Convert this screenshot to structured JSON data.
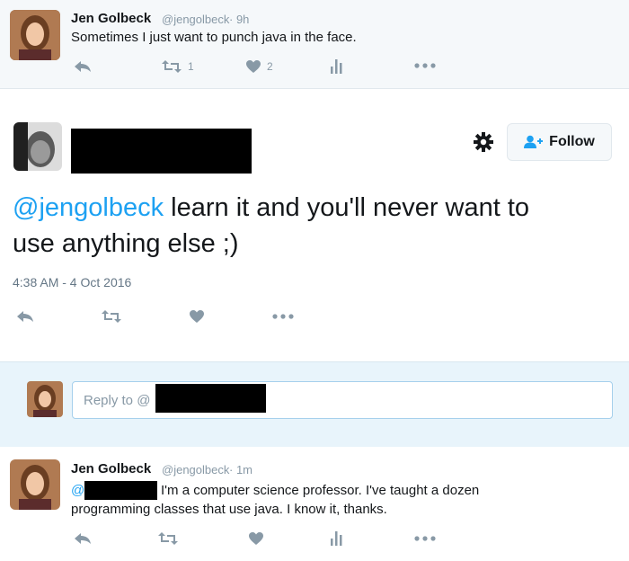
{
  "top_tweet": {
    "name": "Jen Golbeck",
    "handle": "@jengolbeck",
    "time": "· 9h",
    "text": "Sometimes I just want to punch java in the face.",
    "retweet_count": "1",
    "like_count": "2"
  },
  "main_tweet": {
    "follow_label": "Follow",
    "text_mention": "@jengolbeck",
    "text_line1_rest": " learn it and you'll never want to",
    "text_line2": "use anything else ;)",
    "timestamp": "4:38 AM - 4 Oct 2016"
  },
  "reply_box": {
    "placeholder": "Reply to @"
  },
  "bottom_tweet": {
    "name": "Jen Golbeck",
    "handle": "@jengolbeck",
    "time": "· 1m",
    "mention_prefix": "@",
    "text_line1": "I'm a computer science professor. I've taught a dozen",
    "text_line2": "programming classes that use java. I know it, thanks."
  },
  "colors": {
    "link": "#1da1f2",
    "icon_gray": "#8899a6",
    "reply_bg": "#e8f4fb",
    "tweet_bg": "#f5f8fa"
  }
}
